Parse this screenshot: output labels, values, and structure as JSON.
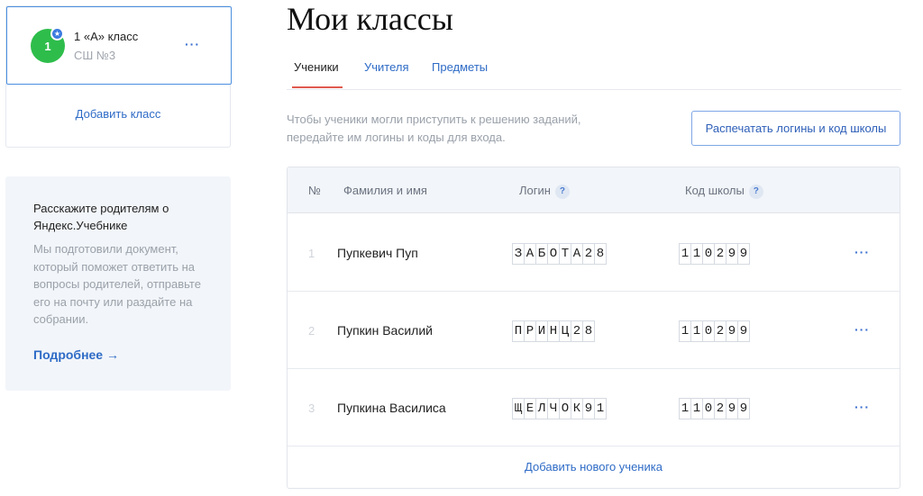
{
  "sidebar": {
    "class_card": {
      "avatar_text": "1",
      "name": "1 «А» класс",
      "school": "СШ №3",
      "menu_label": "···",
      "badge_icon": "star-icon",
      "avatar_color": "#2ebd4b"
    },
    "add_class_label": "Добавить класс",
    "parents": {
      "title": "Расскажите родителям о Яндекс.Учебнике",
      "text": "Мы подготовили документ, который поможет ответить на вопросы родителей, отправьте его на почту или раздайте на собрании.",
      "more_label": "Подробнее →"
    }
  },
  "main": {
    "title": "Мои классы",
    "tabs": [
      {
        "label": "Ученики",
        "active": true
      },
      {
        "label": "Учителя",
        "active": false
      },
      {
        "label": "Предметы",
        "active": false
      }
    ],
    "hint": "Чтобы ученики могли приступить к решению заданий, передайте им логины и коды для входа.",
    "print_button": "Распечатать логины и код школы",
    "table": {
      "headers": {
        "num": "№",
        "name": "Фамилия и имя",
        "login": "Логин",
        "school_code": "Код школы",
        "help_label": "?"
      },
      "rows": [
        {
          "num": "1",
          "name": "Пупкевич Пуп",
          "login": "ЗАБОТА28",
          "code": "110299",
          "menu": "···"
        },
        {
          "num": "2",
          "name": "Пупкин Василий",
          "login": "ПРИНЦ28",
          "code": "110299",
          "menu": "···"
        },
        {
          "num": "3",
          "name": "Пупкина Василиса",
          "login": "ЩЕЛЧОК91",
          "code": "110299",
          "menu": "···"
        }
      ],
      "add_student_label": "Добавить нового ученика"
    }
  },
  "colors": {
    "accent": "#2e6bc6",
    "tab_underline": "#e05a4f",
    "panel_bg": "#f2f5f9"
  }
}
